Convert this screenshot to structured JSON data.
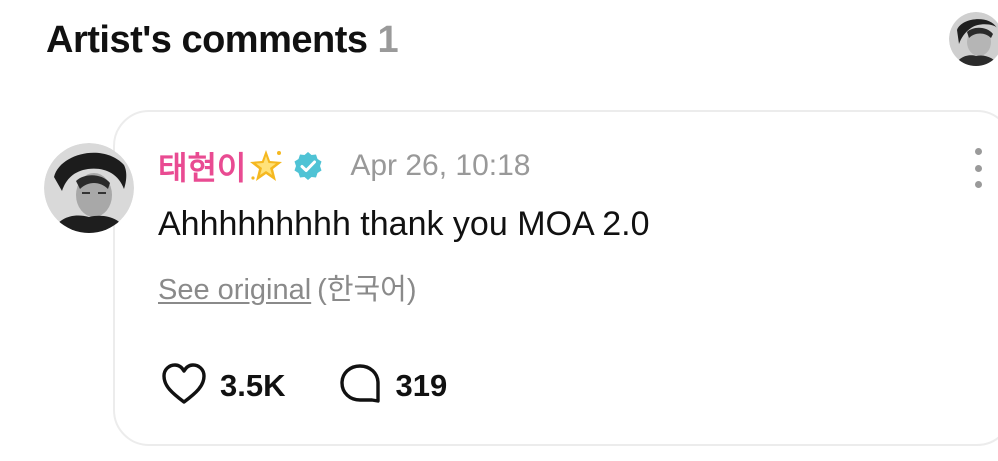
{
  "header": {
    "title": "Artist's comments",
    "count": "1",
    "avatar_icon": "user-avatar-icon"
  },
  "comment": {
    "author": "태현이",
    "author_emoji_icon": "sparkle-star-icon",
    "verified_icon": "verified-badge-icon",
    "timestamp": "Apr 26, 10:18",
    "text": "Ahhhhhhhhh thank you MOA 2.0",
    "see_original": "See original",
    "language": "(한국어)",
    "likes": "3.5K",
    "replies": "319",
    "like_icon": "heart-icon",
    "reply_icon": "comment-bubble-icon",
    "more_icon": "more-vertical-icon"
  },
  "colors": {
    "author_name": "#e94b92",
    "verified": "#4fc3d5",
    "muted_text": "#999999",
    "card_border": "#ececec",
    "sparkle": "#f5b820"
  }
}
